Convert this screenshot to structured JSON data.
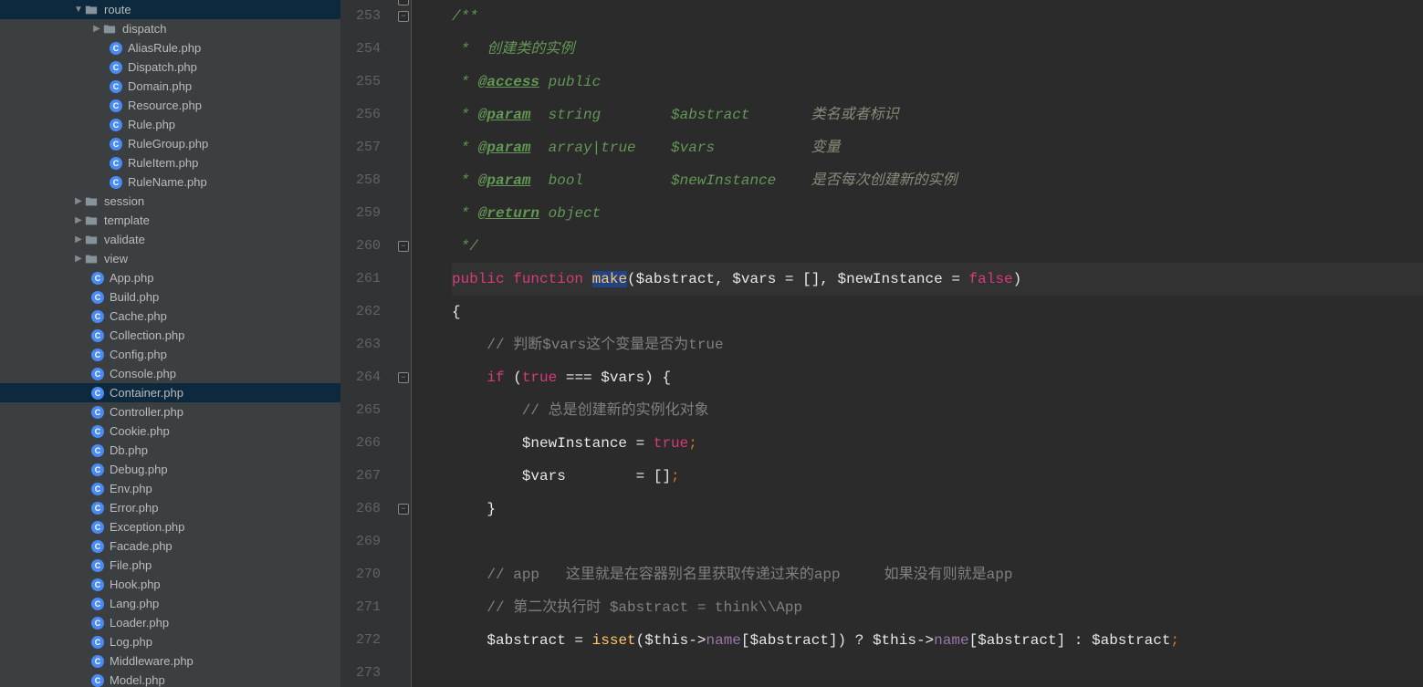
{
  "sidebar": {
    "tree": [
      {
        "type": "folder",
        "name": "route",
        "indent": 80,
        "arrow": "open"
      },
      {
        "type": "folder",
        "name": "dispatch",
        "indent": 100,
        "arrow": "closed"
      },
      {
        "type": "file",
        "name": "AliasRule.php",
        "indent": 120
      },
      {
        "type": "file",
        "name": "Dispatch.php",
        "indent": 120
      },
      {
        "type": "file",
        "name": "Domain.php",
        "indent": 120
      },
      {
        "type": "file",
        "name": "Resource.php",
        "indent": 120
      },
      {
        "type": "file",
        "name": "Rule.php",
        "indent": 120
      },
      {
        "type": "file",
        "name": "RuleGroup.php",
        "indent": 120
      },
      {
        "type": "file",
        "name": "RuleItem.php",
        "indent": 120
      },
      {
        "type": "file",
        "name": "RuleName.php",
        "indent": 120
      },
      {
        "type": "folder",
        "name": "session",
        "indent": 80,
        "arrow": "closed"
      },
      {
        "type": "folder",
        "name": "template",
        "indent": 80,
        "arrow": "closed"
      },
      {
        "type": "folder",
        "name": "validate",
        "indent": 80,
        "arrow": "closed"
      },
      {
        "type": "folder",
        "name": "view",
        "indent": 80,
        "arrow": "closed"
      },
      {
        "type": "file",
        "name": "App.php",
        "indent": 100
      },
      {
        "type": "file",
        "name": "Build.php",
        "indent": 100
      },
      {
        "type": "file",
        "name": "Cache.php",
        "indent": 100
      },
      {
        "type": "file",
        "name": "Collection.php",
        "indent": 100
      },
      {
        "type": "file",
        "name": "Config.php",
        "indent": 100
      },
      {
        "type": "file",
        "name": "Console.php",
        "indent": 100
      },
      {
        "type": "file",
        "name": "Container.php",
        "indent": 100,
        "selected": true
      },
      {
        "type": "file",
        "name": "Controller.php",
        "indent": 100
      },
      {
        "type": "file",
        "name": "Cookie.php",
        "indent": 100
      },
      {
        "type": "file",
        "name": "Db.php",
        "indent": 100
      },
      {
        "type": "file",
        "name": "Debug.php",
        "indent": 100
      },
      {
        "type": "file",
        "name": "Env.php",
        "indent": 100
      },
      {
        "type": "file",
        "name": "Error.php",
        "indent": 100
      },
      {
        "type": "file",
        "name": "Exception.php",
        "indent": 100
      },
      {
        "type": "file",
        "name": "Facade.php",
        "indent": 100
      },
      {
        "type": "file",
        "name": "File.php",
        "indent": 100
      },
      {
        "type": "file",
        "name": "Hook.php",
        "indent": 100
      },
      {
        "type": "file",
        "name": "Lang.php",
        "indent": 100
      },
      {
        "type": "file",
        "name": "Loader.php",
        "indent": 100
      },
      {
        "type": "file",
        "name": "Log.php",
        "indent": 100
      },
      {
        "type": "file",
        "name": "Middleware.php",
        "indent": 100
      },
      {
        "type": "file",
        "name": "Model.php",
        "indent": 100
      }
    ]
  },
  "editor": {
    "startLine": 253,
    "currentLine": 261,
    "foldMarkers": [
      253,
      260,
      264,
      268
    ],
    "lines": {
      "253": {
        "tokens": [
          {
            "t": "/**",
            "c": "c-doc"
          }
        ]
      },
      "254": {
        "tokens": [
          {
            "t": " *  创建类的实例",
            "c": "c-doc"
          }
        ]
      },
      "255": {
        "tokens": [
          {
            "t": " * ",
            "c": "c-doc"
          },
          {
            "t": "@access",
            "c": "c-doc-tag"
          },
          {
            "t": " public",
            "c": "c-doc"
          }
        ]
      },
      "256": {
        "tokens": [
          {
            "t": " * ",
            "c": "c-doc"
          },
          {
            "t": "@param",
            "c": "c-doc-tag"
          },
          {
            "t": "  string        $abstract       ",
            "c": "c-doc"
          },
          {
            "t": "类名或者标识",
            "c": "c-doc-desc"
          }
        ]
      },
      "257": {
        "tokens": [
          {
            "t": " * ",
            "c": "c-doc"
          },
          {
            "t": "@param",
            "c": "c-doc-tag"
          },
          {
            "t": "  array|true    $vars           ",
            "c": "c-doc"
          },
          {
            "t": "变量",
            "c": "c-doc-desc"
          }
        ]
      },
      "258": {
        "tokens": [
          {
            "t": " * ",
            "c": "c-doc"
          },
          {
            "t": "@param",
            "c": "c-doc-tag"
          },
          {
            "t": "  bool          $newInstance    ",
            "c": "c-doc"
          },
          {
            "t": "是否每次创建新的实例",
            "c": "c-doc-desc"
          }
        ]
      },
      "259": {
        "tokens": [
          {
            "t": " * ",
            "c": "c-doc"
          },
          {
            "t": "@return",
            "c": "c-doc-tag"
          },
          {
            "t": " object",
            "c": "c-doc"
          }
        ]
      },
      "260": {
        "tokens": [
          {
            "t": " */",
            "c": "c-doc"
          }
        ]
      },
      "261": {
        "tokens": [
          {
            "t": "public ",
            "c": "c-kw-pink"
          },
          {
            "t": "function ",
            "c": "c-kw-pink"
          },
          {
            "t": "make",
            "c": "c-func-hl"
          },
          {
            "t": "(",
            "c": "c-w"
          },
          {
            "t": "$abstract",
            "c": "c-var-w"
          },
          {
            "t": ", ",
            "c": "c-w"
          },
          {
            "t": "$vars",
            "c": "c-var-w"
          },
          {
            "t": " = [], ",
            "c": "c-w"
          },
          {
            "t": "$newInstance",
            "c": "c-var-w"
          },
          {
            "t": " = ",
            "c": "c-w"
          },
          {
            "t": "false",
            "c": "c-kw-pink"
          },
          {
            "t": ")",
            "c": "c-w"
          }
        ]
      },
      "262": {
        "tokens": [
          {
            "t": "{",
            "c": "c-w"
          }
        ]
      },
      "263": {
        "tokens": [
          {
            "t": "    // ",
            "c": "c-comment"
          },
          {
            "t": "判断$vars这个变量是否为true",
            "c": "c-comment"
          }
        ]
      },
      "264": {
        "tokens": [
          {
            "t": "    ",
            "c": ""
          },
          {
            "t": "if ",
            "c": "c-kw-pink"
          },
          {
            "t": "(",
            "c": "c-w"
          },
          {
            "t": "true ",
            "c": "c-kw-pink"
          },
          {
            "t": "=== ",
            "c": "c-w"
          },
          {
            "t": "$vars",
            "c": "c-var-w"
          },
          {
            "t": ") {",
            "c": "c-w"
          }
        ]
      },
      "265": {
        "tokens": [
          {
            "t": "        // ",
            "c": "c-comment"
          },
          {
            "t": "总是创建新的实例化对象",
            "c": "c-comment"
          }
        ]
      },
      "266": {
        "tokens": [
          {
            "t": "        ",
            "c": ""
          },
          {
            "t": "$newInstance",
            "c": "c-var-w"
          },
          {
            "t": " = ",
            "c": "c-w"
          },
          {
            "t": "true",
            "c": "c-kw-pink"
          },
          {
            "t": ";",
            "c": "c-punct"
          }
        ]
      },
      "267": {
        "tokens": [
          {
            "t": "        ",
            "c": ""
          },
          {
            "t": "$vars",
            "c": "c-var-w"
          },
          {
            "t": "        = []",
            "c": "c-w"
          },
          {
            "t": ";",
            "c": "c-punct"
          }
        ]
      },
      "268": {
        "tokens": [
          {
            "t": "    }",
            "c": "c-w"
          }
        ]
      },
      "269": {
        "tokens": []
      },
      "270": {
        "tokens": [
          {
            "t": "    // app   ",
            "c": "c-comment"
          },
          {
            "t": "这里就是在容器别名里获取传递过来的app     如果没有则就是app",
            "c": "c-comment"
          }
        ]
      },
      "271": {
        "tokens": [
          {
            "t": "    // ",
            "c": "c-comment"
          },
          {
            "t": "第二次执行时 $abstract = think\\\\App",
            "c": "c-comment"
          }
        ]
      },
      "272": {
        "tokens": [
          {
            "t": "    ",
            "c": ""
          },
          {
            "t": "$abstract",
            "c": "c-var-w"
          },
          {
            "t": " = ",
            "c": "c-w"
          },
          {
            "t": "isset",
            "c": "c-func"
          },
          {
            "t": "(",
            "c": "c-w"
          },
          {
            "t": "$this",
            "c": "c-var-w"
          },
          {
            "t": "->",
            "c": "c-w"
          },
          {
            "t": "name",
            "c": "c-var"
          },
          {
            "t": "[",
            "c": "c-w"
          },
          {
            "t": "$abstract",
            "c": "c-var-w"
          },
          {
            "t": "]) ? ",
            "c": "c-w"
          },
          {
            "t": "$this",
            "c": "c-var-w"
          },
          {
            "t": "->",
            "c": "c-w"
          },
          {
            "t": "name",
            "c": "c-var"
          },
          {
            "t": "[",
            "c": "c-w"
          },
          {
            "t": "$abstract",
            "c": "c-var-w"
          },
          {
            "t": "] : ",
            "c": "c-w"
          },
          {
            "t": "$abstract",
            "c": "c-var-w"
          },
          {
            "t": ";",
            "c": "c-punct"
          }
        ]
      },
      "273": {
        "tokens": []
      }
    }
  }
}
